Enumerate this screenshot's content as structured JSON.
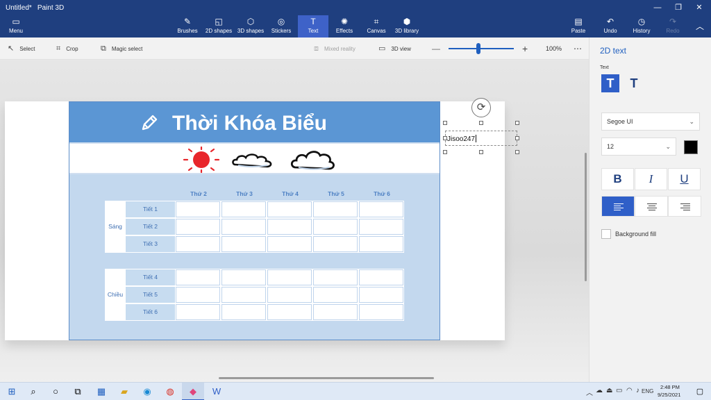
{
  "window": {
    "doc_title": "Untitled*",
    "app_name": "Paint 3D"
  },
  "ribbon": {
    "menu": "Menu",
    "tools": [
      {
        "label": "Brushes"
      },
      {
        "label": "2D shapes"
      },
      {
        "label": "3D shapes"
      },
      {
        "label": "Stickers"
      },
      {
        "label": "Text"
      },
      {
        "label": "Effects"
      },
      {
        "label": "Canvas"
      },
      {
        "label": "3D library"
      }
    ],
    "actions": [
      {
        "label": "Paste"
      },
      {
        "label": "Undo"
      },
      {
        "label": "History"
      },
      {
        "label": "Redo"
      }
    ]
  },
  "toolbar": {
    "select": "Select",
    "crop": "Crop",
    "magic_select": "Magic select",
    "mixed_reality": "Mixed reality",
    "view_3d": "3D view",
    "zoom_level": "100%",
    "zoom_fraction": 0.46
  },
  "poster": {
    "title": "Thời Khóa Biểu",
    "days": [
      "Thứ 2",
      "Thứ 3",
      "Thứ 4",
      "Thứ 5",
      "Thứ 6"
    ],
    "groups": [
      {
        "session": "Sáng",
        "periods": [
          "Tiết 1",
          "Tiết 2",
          "Tiết 3"
        ]
      },
      {
        "session": "Chiều",
        "periods": [
          "Tiết 4",
          "Tiết 5",
          "Tiết 6"
        ]
      }
    ]
  },
  "textbox": {
    "content": "Jisoo247"
  },
  "panel": {
    "title": "2D text",
    "text_label": "Text",
    "font": "Segoe UI",
    "size": "12",
    "text_color": "#000000",
    "bold": "B",
    "italic": "I",
    "underline": "U",
    "alignment": "left",
    "background_fill": "Background fill"
  },
  "taskbar": {
    "language": "ENG",
    "time": "2:48 PM",
    "date": "9/25/2021"
  },
  "colors": {
    "title_bar": "#1f3f7f",
    "accent": "#2f5fc8",
    "poster_header": "#5b96d4",
    "sun": "#e8262b"
  }
}
